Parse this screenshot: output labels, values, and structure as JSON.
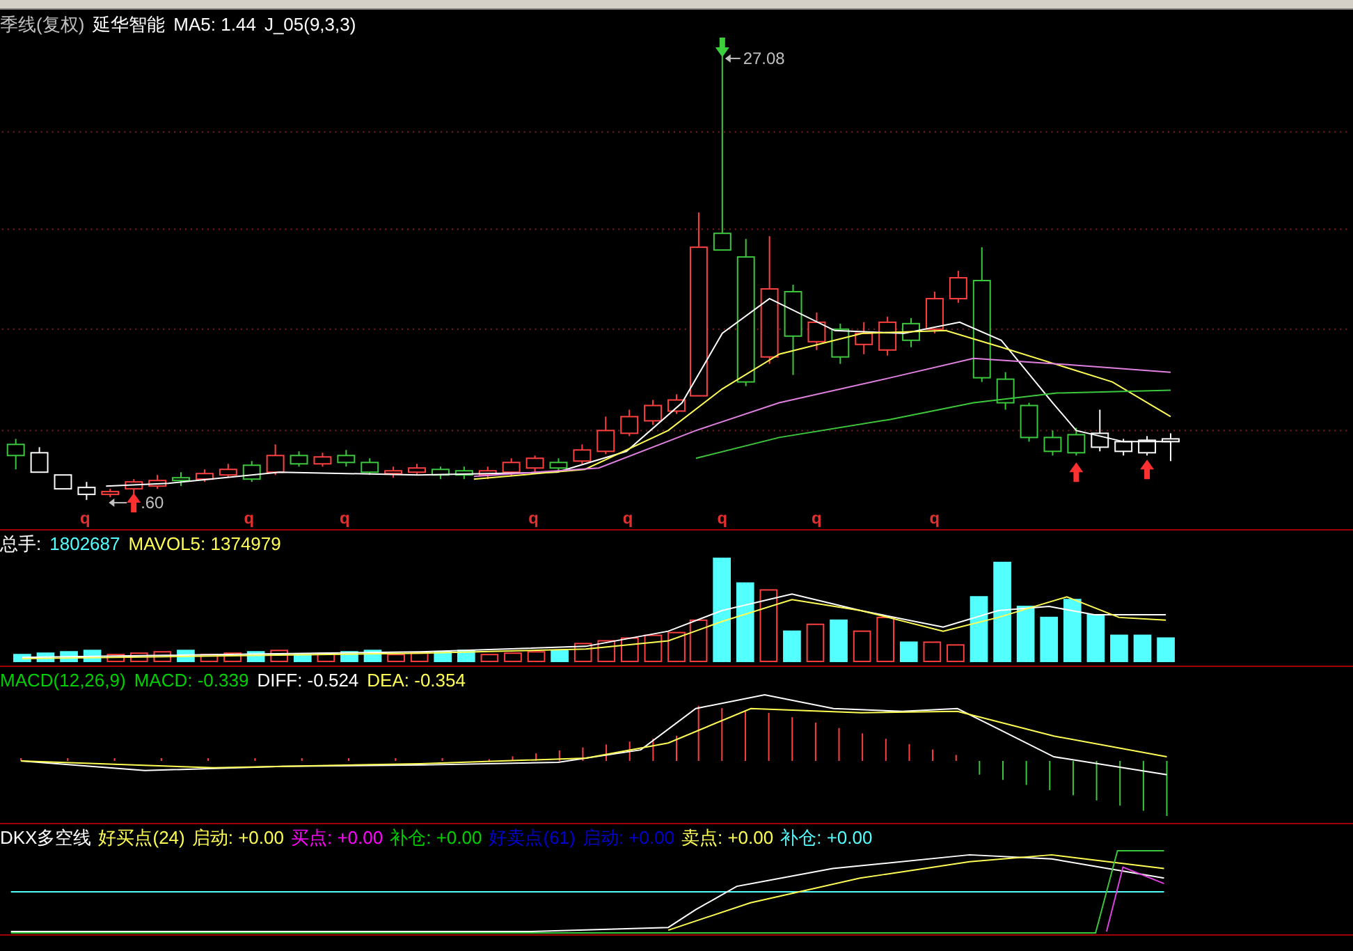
{
  "title_bar": [
    {
      "text": "季线(复权)",
      "color": "#c0c0c0"
    },
    {
      "text": "延华智能",
      "color": "#ffffff"
    },
    {
      "text": "MA5: 1.44",
      "color": "#ffffff"
    },
    {
      "text": "J_05(9,3,3)",
      "color": "#ffffff"
    }
  ],
  "price_panel": {
    "high_label": "27.08",
    "low_label": ".60",
    "markers": [
      "q",
      "q",
      "q",
      "q",
      "q",
      "q",
      "q",
      "q"
    ]
  },
  "volume_legend": [
    {
      "text": "总手:",
      "color": "#ffffff"
    },
    {
      "text": "1802687",
      "color": "#54ffff"
    },
    {
      "text": "MAVOL5: 1374979",
      "color": "#ffff54"
    }
  ],
  "macd_legend": [
    {
      "text": "MACD(12,26,9)",
      "color": "#00d000"
    },
    {
      "text": "MACD: -0.339",
      "color": "#00d000"
    },
    {
      "text": "DIFF: -0.524",
      "color": "#ffffff"
    },
    {
      "text": "DEA: -0.354",
      "color": "#ffff54"
    }
  ],
  "dkx_legend": [
    {
      "text": "DKX多空线",
      "color": "#ffffff"
    },
    {
      "text": "好买点(24)",
      "color": "#ffff54"
    },
    {
      "text": "启动: +0.00",
      "color": "#ffff54"
    },
    {
      "text": "买点: +0.00",
      "color": "#ff00ff"
    },
    {
      "text": "补仓: +0.00",
      "color": "#00d000"
    },
    {
      "text": "好卖点(61)",
      "color": "#0000d0"
    },
    {
      "text": "启动: +0.00",
      "color": "#0000d0"
    },
    {
      "text": "卖点: +0.00",
      "color": "#ffff54"
    },
    {
      "text": "补仓: +0.00",
      "color": "#54ffff"
    }
  ]
}
